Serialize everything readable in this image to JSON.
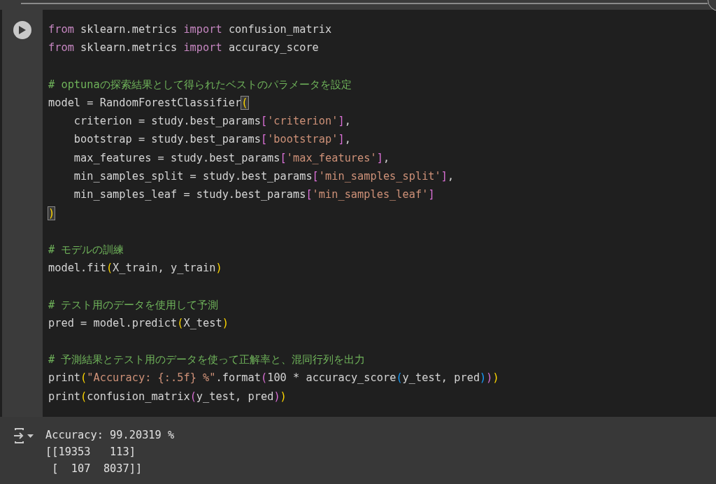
{
  "cell": {
    "code_blocks": [
      [
        [
          {
            "kind": "keyword",
            "text": "from"
          },
          {
            "kind": "text",
            "text": " sklearn.metrics "
          },
          {
            "kind": "keyword",
            "text": "import"
          },
          {
            "kind": "text",
            "text": " confusion_matrix"
          }
        ],
        [
          {
            "kind": "keyword",
            "text": "from"
          },
          {
            "kind": "text",
            "text": " sklearn.metrics "
          },
          {
            "kind": "keyword",
            "text": "import"
          },
          {
            "kind": "text",
            "text": " accuracy_score"
          }
        ]
      ],
      [
        [
          {
            "kind": "comment",
            "text": "# optunaの探索結果として得られたベストのパラメータを設定"
          }
        ],
        [
          {
            "kind": "text",
            "text": "model = RandomForestClassifier"
          },
          {
            "kind": "bracket",
            "text": "(",
            "color": "#ffd700",
            "matched": true
          }
        ],
        [
          {
            "kind": "text",
            "text": "    criterion = study.best_params"
          },
          {
            "kind": "bracket",
            "text": "[",
            "color": "#da70d6",
            "matched": false
          },
          {
            "kind": "string",
            "text": "'criterion'"
          },
          {
            "kind": "bracket",
            "text": "]",
            "color": "#da70d6",
            "matched": false
          },
          {
            "kind": "text",
            "text": ","
          }
        ],
        [
          {
            "kind": "text",
            "text": "    bootstrap = study.best_params"
          },
          {
            "kind": "bracket",
            "text": "[",
            "color": "#da70d6",
            "matched": false
          },
          {
            "kind": "string",
            "text": "'bootstrap'"
          },
          {
            "kind": "bracket",
            "text": "]",
            "color": "#da70d6",
            "matched": false
          },
          {
            "kind": "text",
            "text": ","
          }
        ],
        [
          {
            "kind": "text",
            "text": "    max_features = study.best_params"
          },
          {
            "kind": "bracket",
            "text": "[",
            "color": "#da70d6",
            "matched": false
          },
          {
            "kind": "string",
            "text": "'max_features'"
          },
          {
            "kind": "bracket",
            "text": "]",
            "color": "#da70d6",
            "matched": false
          },
          {
            "kind": "text",
            "text": ","
          }
        ],
        [
          {
            "kind": "text",
            "text": "    min_samples_split = study.best_params"
          },
          {
            "kind": "bracket",
            "text": "[",
            "color": "#da70d6",
            "matched": false
          },
          {
            "kind": "string",
            "text": "'min_samples_split'"
          },
          {
            "kind": "bracket",
            "text": "]",
            "color": "#da70d6",
            "matched": false
          },
          {
            "kind": "text",
            "text": ","
          }
        ],
        [
          {
            "kind": "text",
            "text": "    min_samples_leaf = study.best_params"
          },
          {
            "kind": "bracket",
            "text": "[",
            "color": "#da70d6",
            "matched": false
          },
          {
            "kind": "string",
            "text": "'min_samples_leaf'"
          },
          {
            "kind": "bracket",
            "text": "]",
            "color": "#da70d6",
            "matched": false
          }
        ],
        [
          {
            "kind": "bracket",
            "text": ")",
            "color": "#ffd700",
            "matched": true
          }
        ]
      ],
      [
        [
          {
            "kind": "comment",
            "text": "# モデルの訓練"
          }
        ],
        [
          {
            "kind": "text",
            "text": "model.fit"
          },
          {
            "kind": "bracket",
            "text": "(",
            "color": "#ffd700",
            "matched": false
          },
          {
            "kind": "text",
            "text": "X_train, y_train"
          },
          {
            "kind": "bracket",
            "text": ")",
            "color": "#ffd700",
            "matched": false
          }
        ]
      ],
      [
        [
          {
            "kind": "comment",
            "text": "# テスト用のデータを使用して予測"
          }
        ],
        [
          {
            "kind": "text",
            "text": "pred = model.predict"
          },
          {
            "kind": "bracket",
            "text": "(",
            "color": "#ffd700",
            "matched": false
          },
          {
            "kind": "text",
            "text": "X_test"
          },
          {
            "kind": "bracket",
            "text": ")",
            "color": "#ffd700",
            "matched": false
          }
        ]
      ],
      [
        [
          {
            "kind": "comment",
            "text": "# 予測結果とテスト用のデータを使って正解率と、混同行列を出力"
          }
        ],
        [
          {
            "kind": "text",
            "text": "print"
          },
          {
            "kind": "bracket",
            "text": "(",
            "color": "#ffd700",
            "matched": false
          },
          {
            "kind": "string",
            "text": "\"Accuracy: {:.5f} %\""
          },
          {
            "kind": "text",
            "text": ".format"
          },
          {
            "kind": "bracket",
            "text": "(",
            "color": "#da70d6",
            "matched": false
          },
          {
            "kind": "text",
            "text": "100 * accuracy_score"
          },
          {
            "kind": "bracket",
            "text": "(",
            "color": "#179fff",
            "matched": false
          },
          {
            "kind": "text",
            "text": "y_test, pred"
          },
          {
            "kind": "bracket",
            "text": ")",
            "color": "#179fff",
            "matched": false
          },
          {
            "kind": "bracket",
            "text": ")",
            "color": "#da70d6",
            "matched": false
          },
          {
            "kind": "bracket",
            "text": ")",
            "color": "#ffd700",
            "matched": false
          }
        ],
        [
          {
            "kind": "text",
            "text": "print"
          },
          {
            "kind": "bracket",
            "text": "(",
            "color": "#ffd700",
            "matched": false
          },
          {
            "kind": "text",
            "text": "confusion_matrix"
          },
          {
            "kind": "bracket",
            "text": "(",
            "color": "#da70d6",
            "matched": false
          },
          {
            "kind": "text",
            "text": "y_test, pred"
          },
          {
            "kind": "bracket",
            "text": ")",
            "color": "#da70d6",
            "matched": false
          },
          {
            "kind": "bracket",
            "text": ")",
            "color": "#ffd700",
            "matched": false
          }
        ]
      ]
    ],
    "output": [
      "Accuracy: 99.20319 %",
      "[[19353   113]",
      " [  107  8037]]"
    ]
  }
}
